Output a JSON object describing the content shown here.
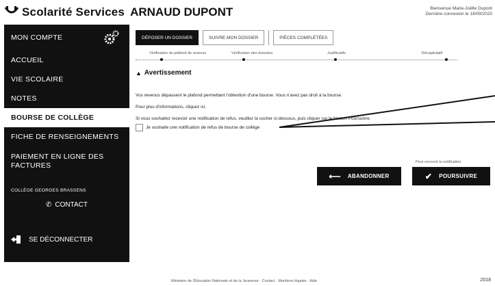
{
  "header": {
    "logo_text": "Scolarité Services",
    "user_name": "ARNAUD DUPONT",
    "welcome_line1": "Bienvenue Marie-Joëlle Dupont",
    "welcome_line2": "Dernière connexion le 18/09/2020"
  },
  "sidebar": {
    "items": [
      {
        "label": "MON COMPTE"
      },
      {
        "label": "ACCUEIL"
      },
      {
        "label": "VIE SCOLAIRE"
      },
      {
        "label": "NOTES"
      },
      {
        "label": "BOURSE DE COLLÈGE"
      },
      {
        "label": "FICHE DE RENSEIGNEMENTS"
      },
      {
        "label": "PAIEMENT EN LIGNE DES FACTURES"
      }
    ],
    "school": "COLLÈGE GEORGES BRASSENS",
    "contact": "CONTACT",
    "logout": "SE DÉCONNECTER"
  },
  "tabs": [
    {
      "label": "DÉPOSER UN DOSSIER",
      "active": true
    },
    {
      "label": "SUIVRE MON DOSSIER",
      "active": false
    },
    {
      "label": "PIÈCES COMPLÉTÉES",
      "active": false
    }
  ],
  "steps": [
    {
      "label": "Vérification du plafond de revenus"
    },
    {
      "label": "Vérification des données"
    },
    {
      "label": "Justificatifs"
    },
    {
      "label": "Récapitulatif"
    }
  ],
  "content": {
    "title": "Avertissement",
    "para1": "Vos revenus dépassent le plafond permettant l'obtention d'une bourse. Vous n'avez pas droit à la bourse.",
    "para2": "Pour plus d'informations, cliquez ici.",
    "para3": "Si vous souhaitez recevoir une notification de refus, veuillez la cocher ci-dessous, puis cliquer sur le bouton Poursuivre.",
    "checkbox_label": "Je souhaite une notification de refus de bourse de collège"
  },
  "actions": {
    "hint": "Pour recevoir la notification",
    "abandon": "ABANDONNER",
    "continue": "POURSUIVRE"
  },
  "footer": {
    "text": "Ministère de l'Éducation Nationale et de la Jeunesse · Contact · Mentions légales · Aide",
    "year": "2018"
  }
}
